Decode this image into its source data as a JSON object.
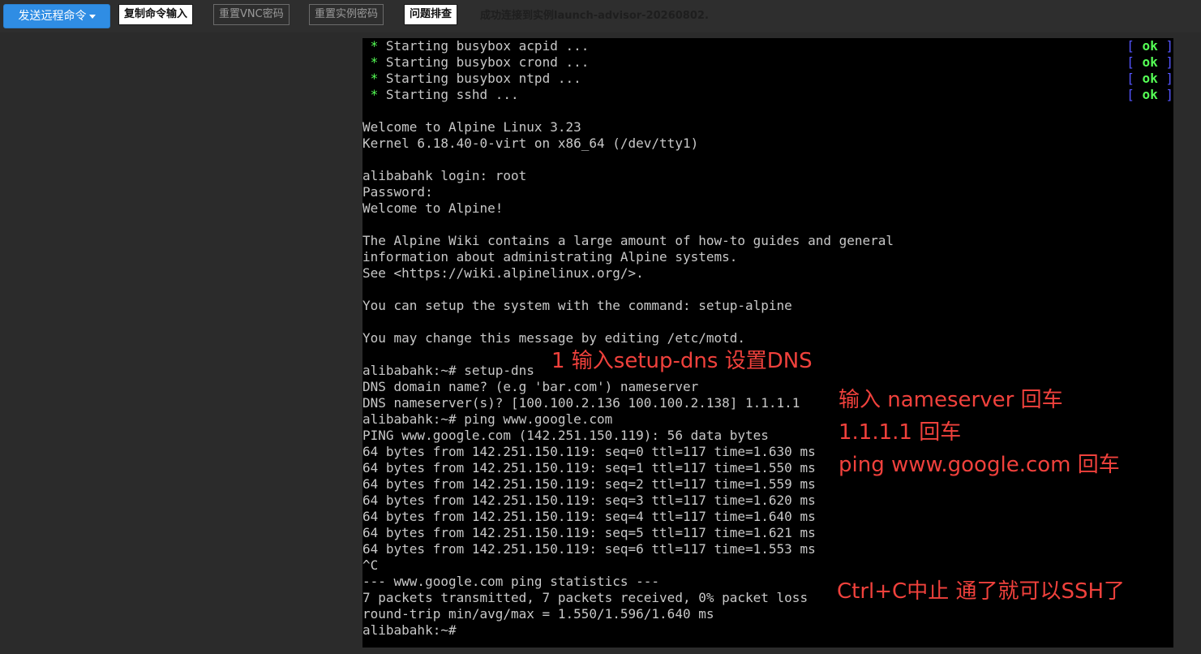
{
  "toolbar": {
    "send_command_label": "发送远程命令",
    "copy_input_label": "复制命令输入",
    "reset_vnc_label": "重置VNC密码",
    "reset_instance_label": "重置实例密码",
    "troubleshoot_label": "问题排查",
    "status": "成功连接到实例launch-advisor-20260802."
  },
  "terminal": {
    "boot_lines": [
      {
        "star": " * ",
        "text": "Starting busybox acpid ...",
        "ok_open": "[ ",
        "ok": "ok",
        "ok_close": " ]"
      },
      {
        "star": " * ",
        "text": "Starting busybox crond ...",
        "ok_open": "[ ",
        "ok": "ok",
        "ok_close": " ]"
      },
      {
        "star": " * ",
        "text": "Starting busybox ntpd ...",
        "ok_open": "[ ",
        "ok": "ok",
        "ok_close": " ]"
      },
      {
        "star": " * ",
        "text": "Starting sshd ...",
        "ok_open": "[ ",
        "ok": "ok",
        "ok_close": " ]"
      }
    ],
    "lines": [
      "",
      "Welcome to Alpine Linux 3.23",
      "Kernel 6.18.40-0-virt on x86_64 (/dev/tty1)",
      "",
      "alibabahk login: root",
      "Password:",
      "Welcome to Alpine!",
      "",
      "The Alpine Wiki contains a large amount of how-to guides and general",
      "information about administrating Alpine systems.",
      "See <https://wiki.alpinelinux.org/>.",
      "",
      "You can setup the system with the command: setup-alpine",
      "",
      "You may change this message by editing /etc/motd.",
      "",
      "alibabahk:~# setup-dns",
      "DNS domain name? (e.g 'bar.com') nameserver",
      "DNS nameserver(s)? [100.100.2.136 100.100.2.138] 1.1.1.1",
      "alibabahk:~# ping www.google.com",
      "PING www.google.com (142.251.150.119): 56 data bytes",
      "64 bytes from 142.251.150.119: seq=0 ttl=117 time=1.630 ms",
      "64 bytes from 142.251.150.119: seq=1 ttl=117 time=1.550 ms",
      "64 bytes from 142.251.150.119: seq=2 ttl=117 time=1.559 ms",
      "64 bytes from 142.251.150.119: seq=3 ttl=117 time=1.620 ms",
      "64 bytes from 142.251.150.119: seq=4 ttl=117 time=1.640 ms",
      "64 bytes from 142.251.150.119: seq=5 ttl=117 time=1.621 ms",
      "64 bytes from 142.251.150.119: seq=6 ttl=117 time=1.553 ms",
      "^C",
      "--- www.google.com ping statistics ---",
      "7 packets transmitted, 7 packets received, 0% packet loss",
      "round-trip min/avg/max = 1.550/1.596/1.640 ms",
      "alibabahk:~#"
    ]
  },
  "annotations": {
    "step1": "1 输入setup-dns 设置DNS",
    "step2": "输入 nameserver 回车",
    "step3": "1.1.1.1 回车",
    "step4": "ping www.google.com 回车",
    "step5": "Ctrl+C中止 通了就可以SSH了"
  },
  "colors": {
    "primary_button": "#2f8de4",
    "terminal_bg": "#000000",
    "terminal_text": "#c8c8c8",
    "ok_green": "#55ff55",
    "bracket_blue": "#5555ff",
    "annotation_red": "#f0413c"
  }
}
